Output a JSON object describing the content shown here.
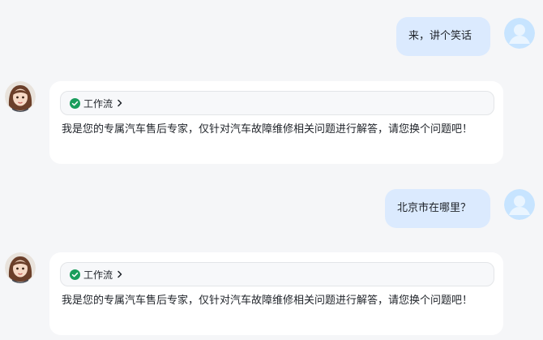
{
  "messages": [
    {
      "role": "user",
      "text": "来，讲个笑话"
    },
    {
      "role": "assistant",
      "workflow_label": "工作流",
      "text": "我是您的专属汽车售后专家，仅针对汽车故障维修相关问题进行解答，请您换个问题吧！"
    },
    {
      "role": "user",
      "text": "北京市在哪里？"
    },
    {
      "role": "assistant",
      "workflow_label": "工作流",
      "text": "我是您的专属汽车售后专家，仅针对汽车故障维修相关问题进行解答，请您换个问题吧！"
    }
  ],
  "icons": {
    "user_avatar": "user-silhouette-icon",
    "bot_avatar": "assistant-girl-avatar",
    "workflow_status": "check-circle-icon",
    "workflow_expand": "chevron-right-icon"
  },
  "colors": {
    "background": "#f5f6f8",
    "user_bubble": "#dbeafe",
    "bot_card": "#ffffff",
    "check": "#1a9d5c",
    "user_avatar_bg": "#bfe0ff"
  }
}
